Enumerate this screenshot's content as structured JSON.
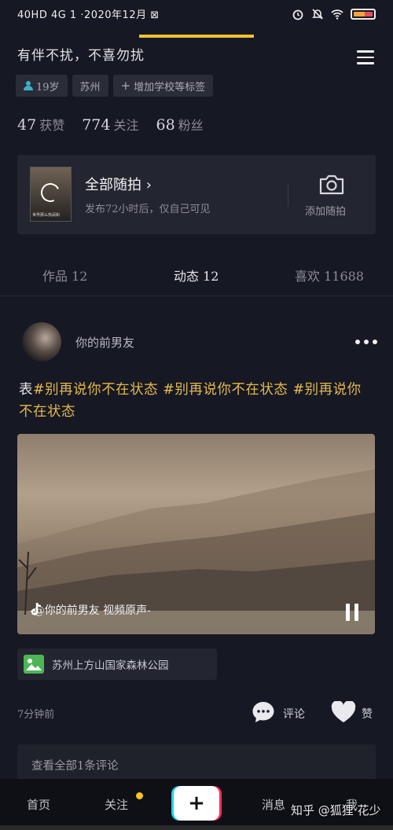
{
  "status": {
    "left_text": "40HD 4G 1 ·2020年12月 ⊠",
    "battery_color": "#e84a5f"
  },
  "profile": {
    "signature": "有伴不扰，不喜勿扰",
    "tags": [
      "19岁",
      "苏州",
      "增加学校等标签"
    ],
    "stats": [
      {
        "num": "47",
        "label": "获赞"
      },
      {
        "num": "774",
        "label": "关注"
      },
      {
        "num": "68",
        "label": "粉丝"
      }
    ]
  },
  "story_card": {
    "title": "全部随拍",
    "subtitle": "发布72小时后，仅自己可见",
    "thumb_caption": "世界那么热闹和",
    "add_label": "添加随拍"
  },
  "tabs": [
    {
      "label": "作品 12",
      "active": false
    },
    {
      "label": "动态 12",
      "active": true
    },
    {
      "label": "喜欢 11688",
      "active": false
    }
  ],
  "post": {
    "author": "你的前男友",
    "caption_prefix": "表",
    "caption_tags": "#别再说你不在状态 #别再说你不在状态 #别再说你不在状态",
    "video_info": "-@你的前男友  视频原声-",
    "location": "苏州上方山国家森林公园",
    "time": "7分钟前",
    "comment_label": "评论",
    "like_label": "赞",
    "view_all": "查看全部1条评论"
  },
  "nav": {
    "items": [
      "首页",
      "关注",
      "消息",
      "我"
    ],
    "plus": "+",
    "accent_dot": "#f5c518"
  },
  "watermark": "知乎 @狐狸·花少"
}
